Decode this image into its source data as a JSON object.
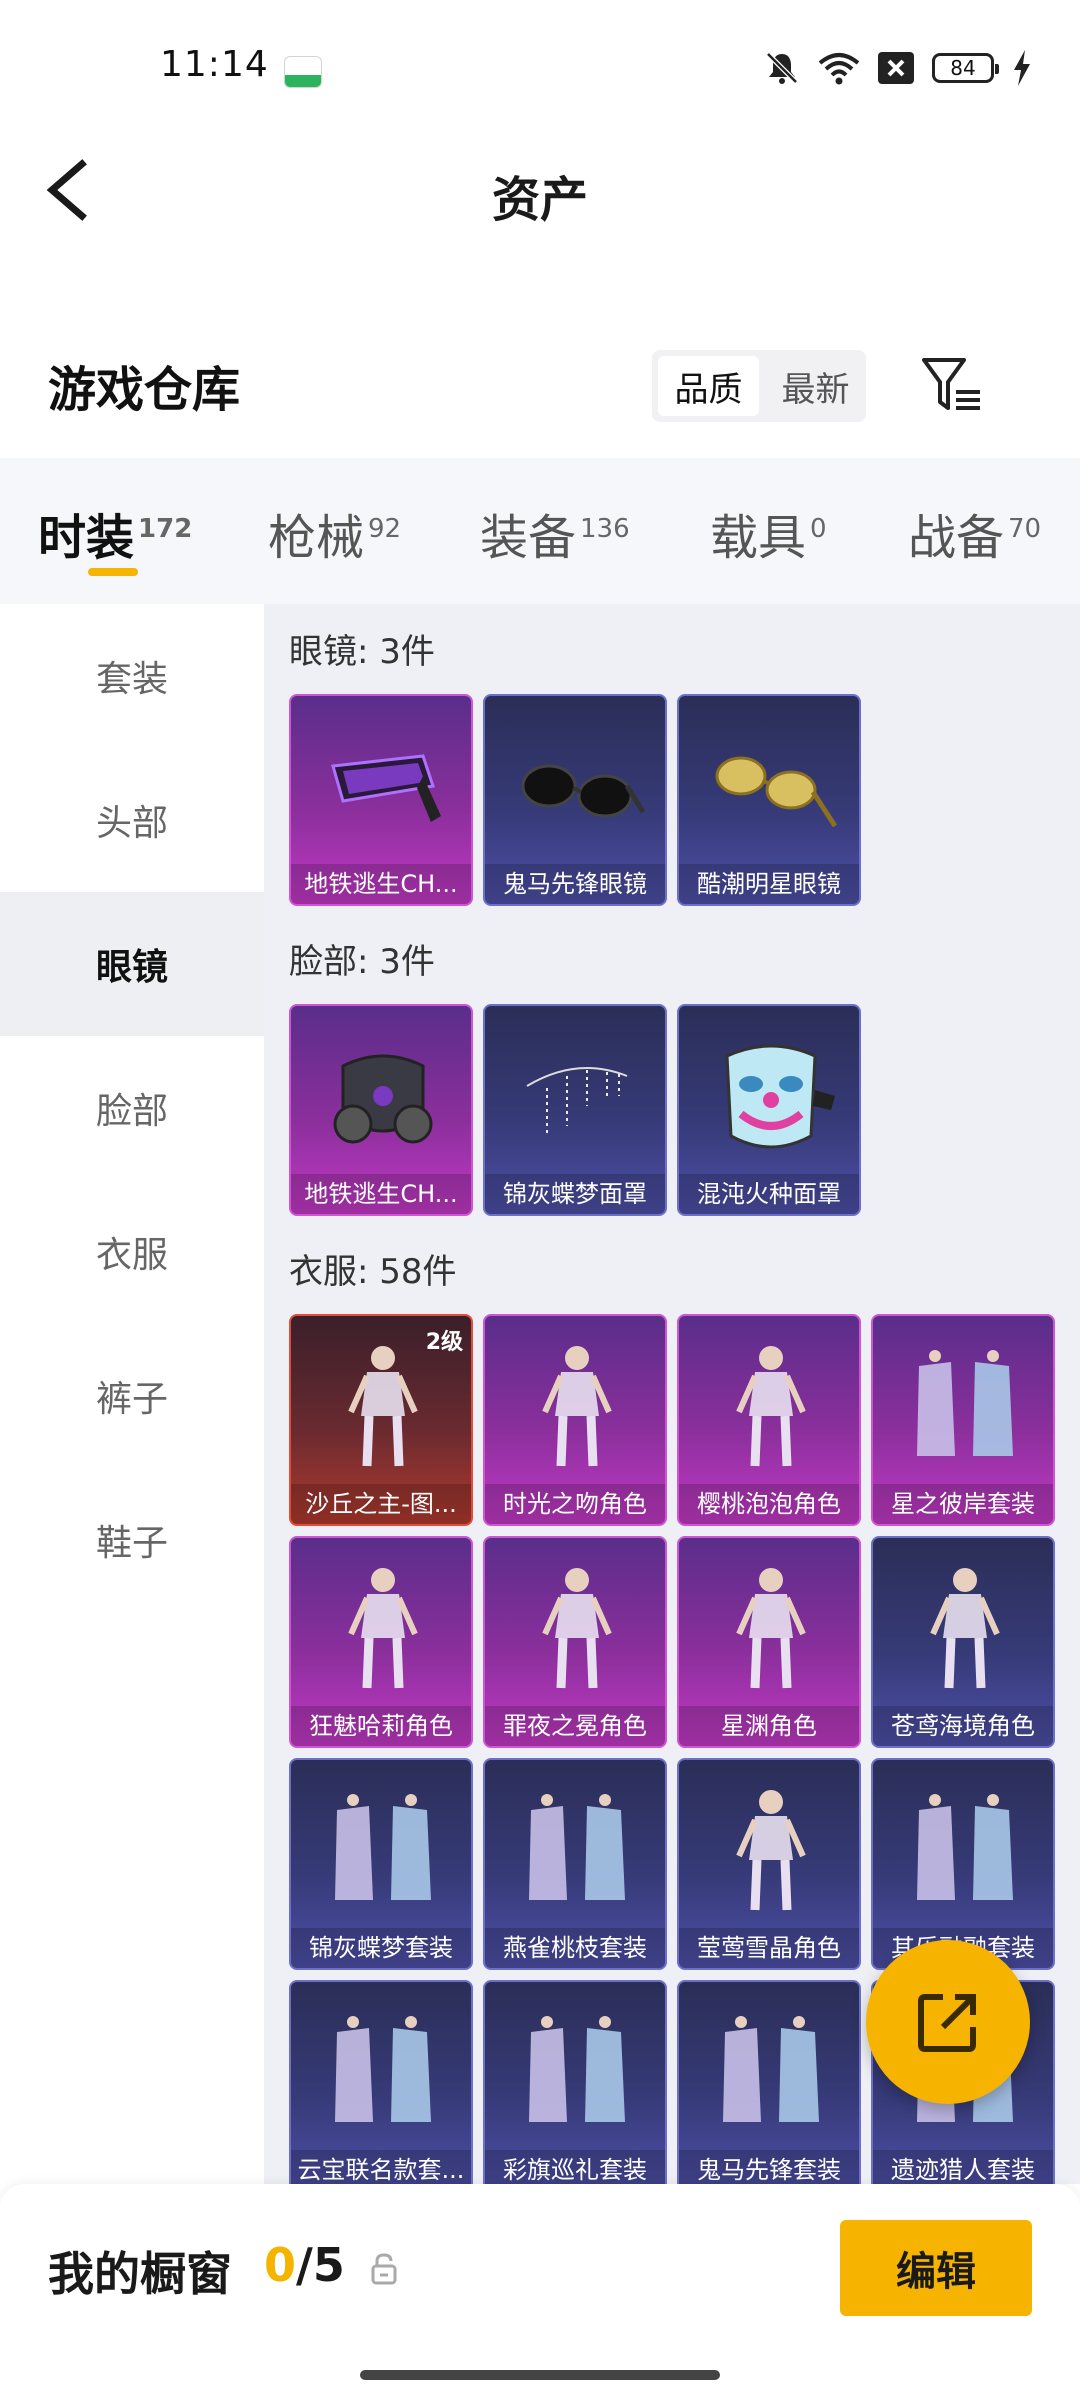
{
  "status_bar": {
    "time": "11:14",
    "battery": "84"
  },
  "header": {
    "title": "资产"
  },
  "warehouse": {
    "title": "游戏仓库",
    "sort_options": [
      {
        "label": "品质",
        "active": true
      },
      {
        "label": "最新",
        "active": false
      }
    ]
  },
  "categories": [
    {
      "label": "时装",
      "count": "172",
      "active": true
    },
    {
      "label": "枪械",
      "count": "92",
      "active": false
    },
    {
      "label": "装备",
      "count": "136",
      "active": false
    },
    {
      "label": "载具",
      "count": "0",
      "active": false
    },
    {
      "label": "战备",
      "count": "70",
      "active": false
    }
  ],
  "sidebar": {
    "items": [
      {
        "label": "套装",
        "active": false
      },
      {
        "label": "头部",
        "active": false
      },
      {
        "label": "眼镜",
        "active": true
      },
      {
        "label": "脸部",
        "active": false
      },
      {
        "label": "衣服",
        "active": false
      },
      {
        "label": "裤子",
        "active": false
      },
      {
        "label": "鞋子",
        "active": false
      }
    ]
  },
  "sections": [
    {
      "title": "眼镜: 3件",
      "items": [
        {
          "name": "地铁逃生CH...",
          "rarity": "purple",
          "art": "goggles"
        },
        {
          "name": "鬼马先锋眼镜",
          "rarity": "blue",
          "art": "sunglasses"
        },
        {
          "name": "酷潮明星眼镜",
          "rarity": "blue",
          "art": "gold-glasses"
        }
      ]
    },
    {
      "title": "脸部: 3件",
      "items": [
        {
          "name": "地铁逃生CH...",
          "rarity": "purple",
          "art": "gas-mask"
        },
        {
          "name": "锦灰蝶梦面罩",
          "rarity": "blue",
          "art": "chain-mask"
        },
        {
          "name": "混沌火种面罩",
          "rarity": "blue",
          "art": "clown-mask"
        }
      ]
    },
    {
      "title": "衣服: 58件",
      "items": [
        {
          "name": "沙丘之主-图...",
          "rarity": "red",
          "art": "figure",
          "level": "2级"
        },
        {
          "name": "时光之吻角色",
          "rarity": "purple",
          "art": "figure"
        },
        {
          "name": "樱桃泡泡角色",
          "rarity": "purple",
          "art": "figure"
        },
        {
          "name": "星之彼岸套装",
          "rarity": "purple",
          "art": "outfit"
        },
        {
          "name": "狂魅哈莉角色",
          "rarity": "purple",
          "art": "figure"
        },
        {
          "name": "罪夜之冕角色",
          "rarity": "purple",
          "art": "figure"
        },
        {
          "name": "星渊角色",
          "rarity": "purple",
          "art": "figure"
        },
        {
          "name": "苍鸢海境角色",
          "rarity": "blue",
          "art": "figure"
        },
        {
          "name": "锦灰蝶梦套装",
          "rarity": "blue",
          "art": "outfit"
        },
        {
          "name": "燕雀桃枝套装",
          "rarity": "blue",
          "art": "outfit"
        },
        {
          "name": "莹莺雪晶角色",
          "rarity": "blue",
          "art": "figure"
        },
        {
          "name": "其乐融融套装",
          "rarity": "blue",
          "art": "outfit"
        },
        {
          "name": "云宝联名款套...",
          "rarity": "blue",
          "art": "outfit"
        },
        {
          "name": "彩旗巡礼套装",
          "rarity": "blue",
          "art": "outfit"
        },
        {
          "name": "鬼马先锋套装",
          "rarity": "blue",
          "art": "outfit"
        },
        {
          "name": "遗迹猎人套装",
          "rarity": "blue",
          "art": "outfit"
        }
      ]
    }
  ],
  "showcase": {
    "title": "我的橱窗",
    "current": "0",
    "total": "/5"
  },
  "edit_label": "编辑",
  "colors": {
    "accent": "#f6b400",
    "purple_rarity": "#c139c4",
    "blue_rarity": "#4d4fa6",
    "red_rarity": "#b03a2e"
  },
  "icons": [
    "back-arrow-icon",
    "filter-icon",
    "share-icon",
    "lock-icon",
    "mute-icon",
    "wifi-icon",
    "signal-icon",
    "battery-icon",
    "charging-icon"
  ]
}
